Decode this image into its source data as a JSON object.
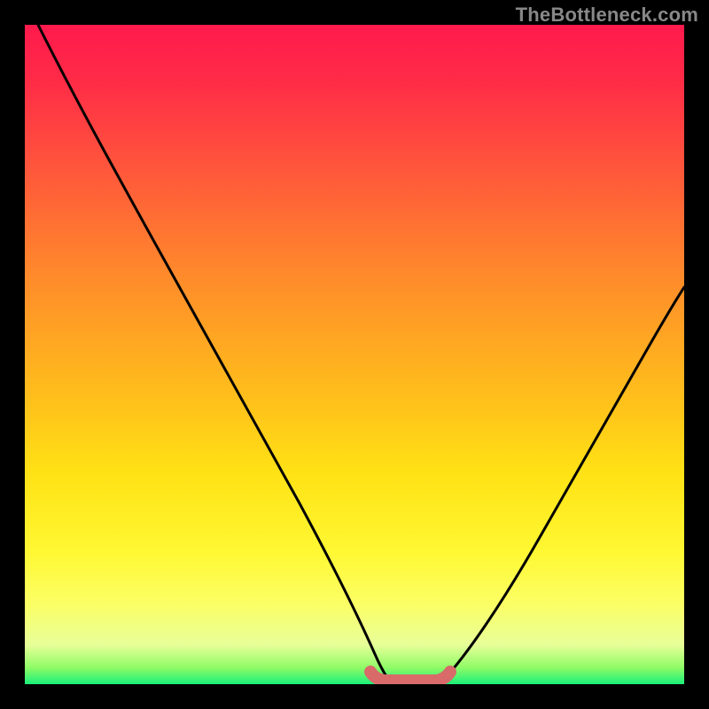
{
  "attribution": "TheBottleneck.com",
  "colors": {
    "background": "#000000",
    "gradient_top": "#ff1a4d",
    "gradient_mid1": "#ff8a2b",
    "gradient_mid2": "#ffe215",
    "gradient_bottom": "#19f07a",
    "curve": "#000000",
    "marker": "#d86a6a"
  },
  "chart_data": {
    "type": "line",
    "title": "",
    "xlabel": "",
    "ylabel": "",
    "xlim": [
      0,
      100
    ],
    "ylim": [
      0,
      100
    ],
    "series": [
      {
        "name": "left-curve",
        "x": [
          2,
          6,
          10,
          14,
          18,
          22,
          26,
          30,
          34,
          38,
          42,
          46,
          50,
          52
        ],
        "y": [
          100,
          92,
          83,
          75,
          66,
          58,
          49,
          41,
          32,
          24,
          16,
          9,
          3,
          1
        ]
      },
      {
        "name": "right-curve",
        "x": [
          62,
          66,
          70,
          74,
          78,
          82,
          86,
          90,
          94,
          98,
          100
        ],
        "y": [
          1,
          4,
          9,
          15,
          22,
          29,
          36,
          43,
          50,
          57,
          60
        ]
      },
      {
        "name": "optimal-zone-marker",
        "x": [
          51,
          53,
          55,
          57,
          59,
          61,
          63
        ],
        "y": [
          2,
          1,
          1,
          1,
          1,
          1,
          2
        ]
      }
    ]
  }
}
